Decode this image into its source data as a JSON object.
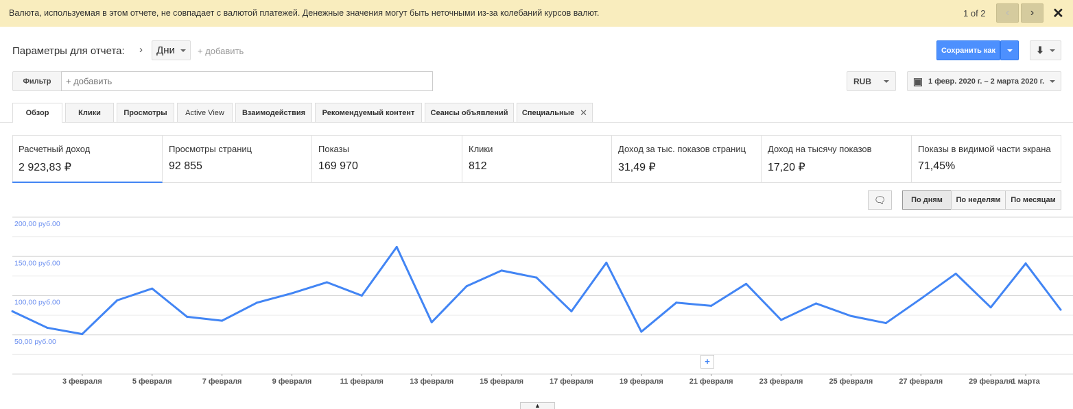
{
  "banner": {
    "message": "Валюта, используемая в этом отчете, не совпадает с валютой платежей. Денежные значения могут быть неточными из-за колебаний курсов валют.",
    "pager": "1 of 2",
    "prev": "‹",
    "next": "›",
    "close": "✕"
  },
  "params": {
    "label": "Параметры для отчета:",
    "dimension": "Дни",
    "add": "+ добавить"
  },
  "save": {
    "label": "Сохранить как"
  },
  "filter": {
    "label": "Фильтр",
    "placeholder": "+ добавить"
  },
  "currency": "RUB",
  "date_range": "1 февр. 2020 г. – 2 марта 2020 г.",
  "tabs": [
    "Обзор",
    "Клики",
    "Просмотры",
    "Active View",
    "Взаимодействия",
    "Рекомендуемый контент",
    "Сеансы объявлений",
    "Специальные"
  ],
  "metrics": [
    {
      "title": "Расчетный доход",
      "value": "2 923,83 ₽"
    },
    {
      "title": "Просмотры страниц",
      "value": "92 855"
    },
    {
      "title": "Показы",
      "value": "169 970"
    },
    {
      "title": "Клики",
      "value": "812"
    },
    {
      "title": "Доход за тыс. показов страниц",
      "value": "31,49 ₽"
    },
    {
      "title": "Доход на тысячу показов",
      "value": "17,20 ₽"
    },
    {
      "title": "Показы в видимой части экрана",
      "value": "71,45%"
    }
  ],
  "periods": [
    "По дням",
    "По неделям",
    "По месяцам"
  ],
  "colors": {
    "accent": "#4285f4",
    "banner": "#f9edbe"
  },
  "chart_data": {
    "type": "line",
    "ylim": [
      0,
      200
    ],
    "yticks": [
      {
        "v": 200,
        "label": "200,00 руб.00"
      },
      {
        "v": 150,
        "label": "150,00 руб.00"
      },
      {
        "v": 100,
        "label": "100,00 руб.00"
      },
      {
        "v": 50,
        "label": "50,00 руб.00"
      }
    ],
    "x": [
      "1 февраля",
      "2 февраля",
      "3 февраля",
      "4 февраля",
      "5 февраля",
      "6 февраля",
      "7 февраля",
      "8 февраля",
      "9 февраля",
      "10 февраля",
      "11 февраля",
      "12 февраля",
      "13 февраля",
      "14 февраля",
      "15 февраля",
      "16 февраля",
      "17 февраля",
      "18 февраля",
      "19 февраля",
      "20 февраля",
      "21 февраля",
      "22 февраля",
      "23 февраля",
      "24 февраля",
      "25 февраля",
      "26 февраля",
      "27 февраля",
      "28 февраля",
      "29 февраля",
      "1 марта",
      "2 марта"
    ],
    "xtick_labels": [
      "3 февраля",
      "5 февраля",
      "7 февраля",
      "9 февраля",
      "11 февраля",
      "13 февраля",
      "15 февраля",
      "17 февраля",
      "19 февраля",
      "21 февраля",
      "23 февраля",
      "25 февраля",
      "27 февраля",
      "29 февраля",
      "1 марта"
    ],
    "values": [
      80,
      59,
      51,
      94,
      109,
      73,
      68,
      91,
      103,
      117,
      100,
      162,
      66,
      112,
      132,
      123,
      80,
      142,
      54,
      91,
      87,
      115,
      69,
      90,
      74,
      65,
      96,
      128,
      85,
      141,
      82
    ],
    "grid": true
  }
}
